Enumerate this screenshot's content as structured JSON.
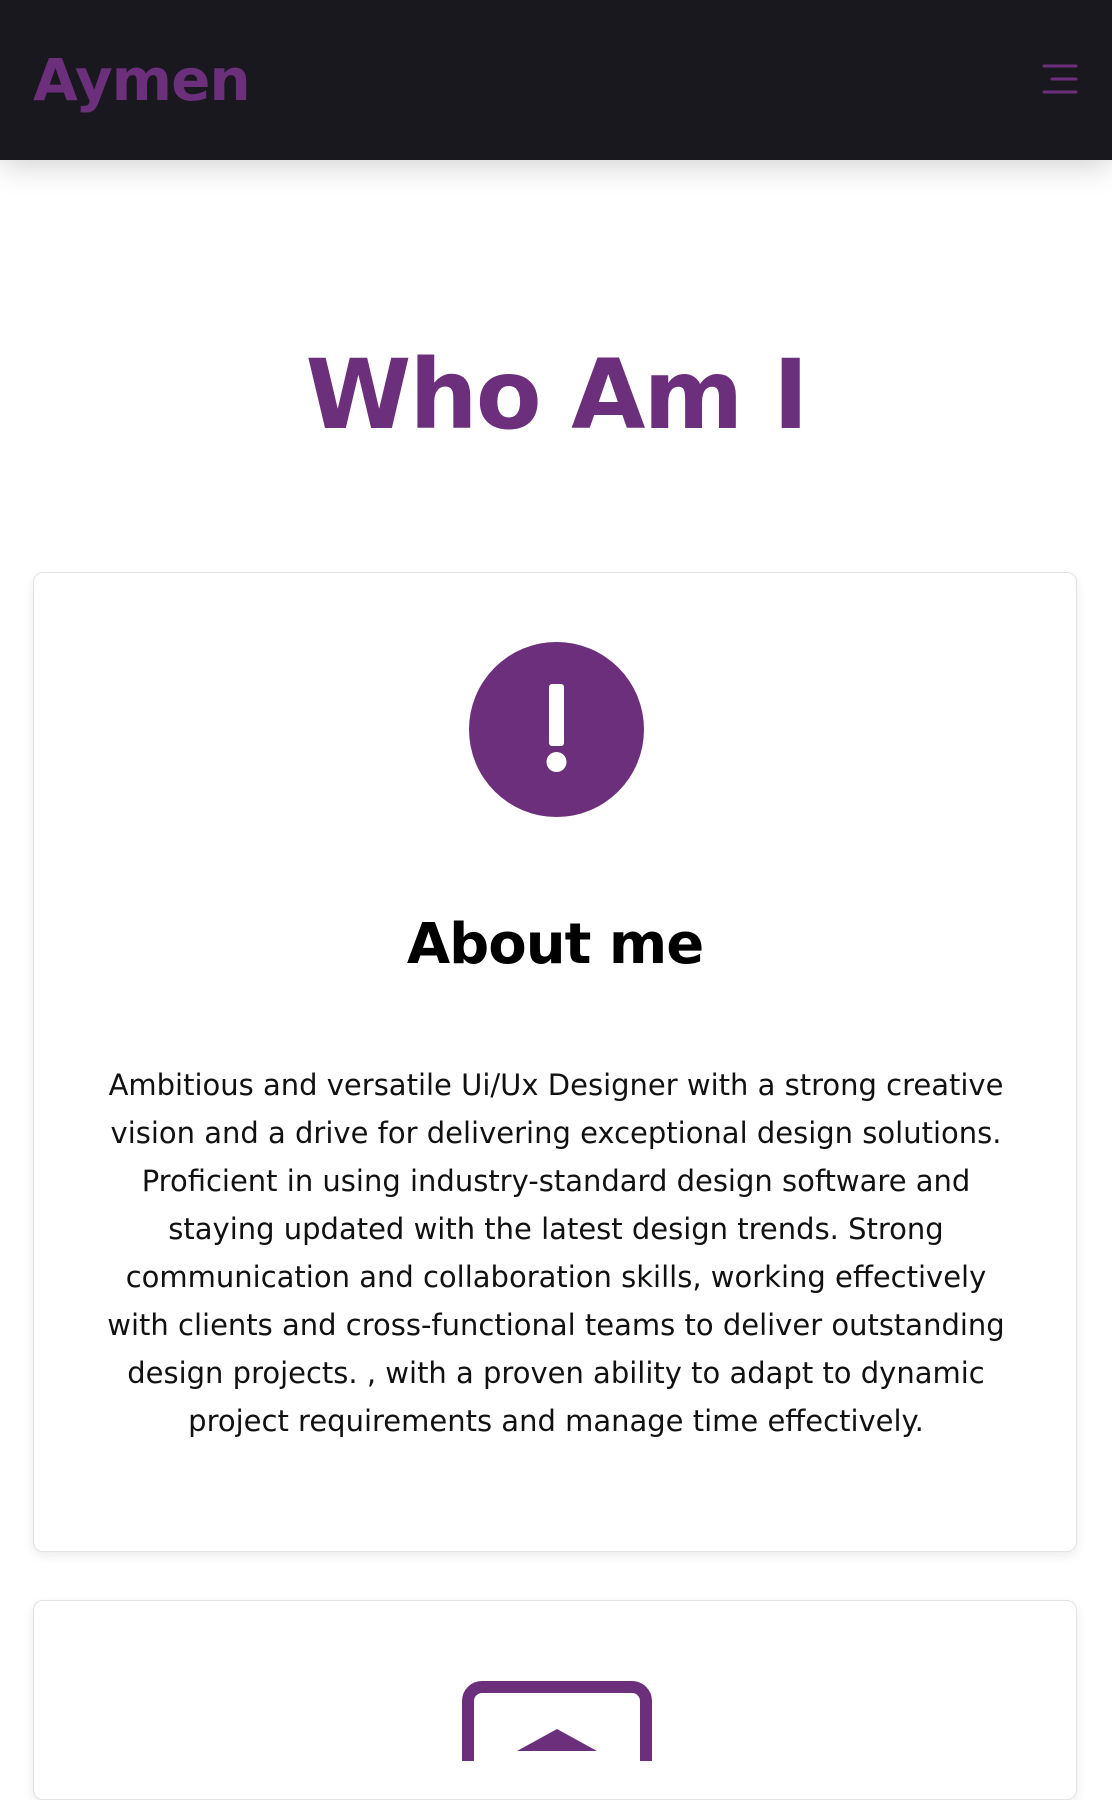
{
  "navbar": {
    "brand": "Aymen",
    "menu_icon": "hamburger-menu-icon"
  },
  "section": {
    "title": "Who Am I"
  },
  "about_card": {
    "icon": "exclamation-circle-icon",
    "heading": "About me",
    "text": "Ambitious and versatile Ui/Ux Designer with a strong creative vision and a drive for delivering exceptional design solutions. Proficient in using industry-standard design software and staying updated with the latest design trends. Strong communication and collaboration skills, working effectively with clients and cross-functional teams to deliver outstanding design projects. , with a proven ability to adapt to dynamic project requirements and manage time effectively."
  },
  "next_card": {
    "icon": "envelope-icon"
  },
  "colors": {
    "accent": "#6c2f7c",
    "navbar_bg": "#18181e",
    "text": "#111111",
    "heading": "#000000",
    "page_bg": "#ffffff"
  }
}
